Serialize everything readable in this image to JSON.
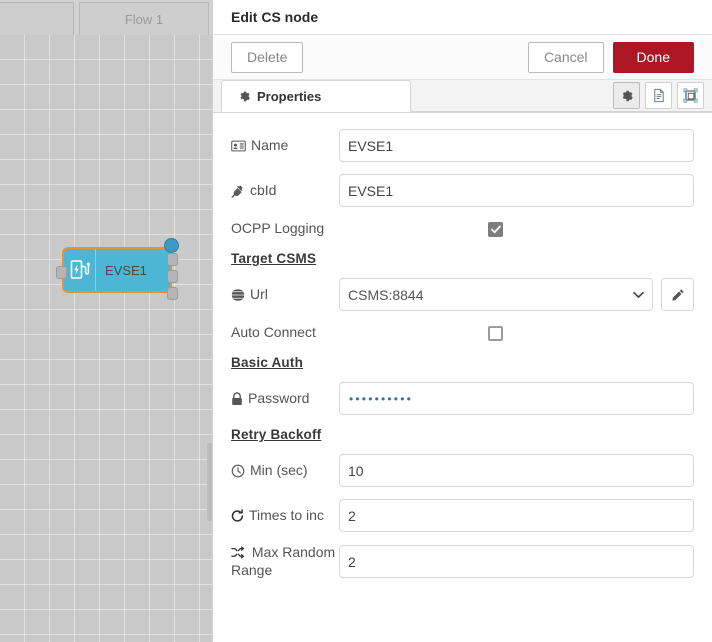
{
  "workspace": {
    "tabs": [
      {
        "label": "",
        "active": false
      },
      {
        "label": "Flow 1",
        "active": true
      }
    ],
    "node": {
      "label": "EVSE1",
      "icon": "ev-charging-station-icon",
      "fill": "#4cb6d4",
      "selected_border": "#e8913d",
      "inputs": 1,
      "outputs": 3
    }
  },
  "dialog": {
    "title": "Edit CS node",
    "actions": {
      "delete_label": "Delete",
      "cancel_label": "Cancel",
      "done_label": "Done",
      "done_color": "#ad1625"
    },
    "tabs": [
      {
        "label": "Properties",
        "icon": "gear-icon",
        "active": true
      }
    ],
    "tools": [
      {
        "name": "properties-tool",
        "icon": "gear-icon",
        "active": true
      },
      {
        "name": "description-tool",
        "icon": "document-icon",
        "active": false
      },
      {
        "name": "appearance-tool",
        "icon": "appearance-icon",
        "active": false
      }
    ],
    "form": [
      {
        "kind": "text",
        "name": "name",
        "label": "Name",
        "icon": "id-card-icon",
        "value": "EVSE1",
        "placeholder": "Name"
      },
      {
        "kind": "text",
        "name": "cbid",
        "label": "cbId",
        "icon": "plug-icon",
        "value": "EVSE1",
        "placeholder": ""
      },
      {
        "kind": "checkbox",
        "name": "ocpp-logging",
        "label": "OCPP Logging",
        "icon": "",
        "checked": true
      },
      {
        "kind": "section",
        "name": "target-csms",
        "label": "Target CSMS"
      },
      {
        "kind": "select",
        "name": "url",
        "label": "Url",
        "icon": "globe-icon",
        "value": "CSMS:8844",
        "options": [
          "CSMS:8844"
        ],
        "edit_button_icon": "pencil-icon"
      },
      {
        "kind": "checkbox",
        "name": "auto-connect",
        "label": "Auto Connect",
        "icon": "",
        "checked": false
      },
      {
        "kind": "section",
        "name": "basic-auth",
        "label": "Basic Auth"
      },
      {
        "kind": "password",
        "name": "password",
        "label": "Password",
        "icon": "lock-icon",
        "value": "••••••••••",
        "placeholder": ""
      },
      {
        "kind": "section",
        "name": "retry-backoff",
        "label": "Retry Backoff"
      },
      {
        "kind": "text",
        "name": "min-sec",
        "label": "Min (sec)",
        "icon": "clock-icon",
        "value": "10",
        "placeholder": ""
      },
      {
        "kind": "text",
        "name": "times-to-inc",
        "label": "Times to inc",
        "icon": "refresh-icon",
        "value": "2",
        "placeholder": ""
      },
      {
        "kind": "text",
        "name": "max-random-range",
        "label": "Max Random Range",
        "icon": "shuffle-icon",
        "value": "2",
        "placeholder": ""
      }
    ]
  }
}
